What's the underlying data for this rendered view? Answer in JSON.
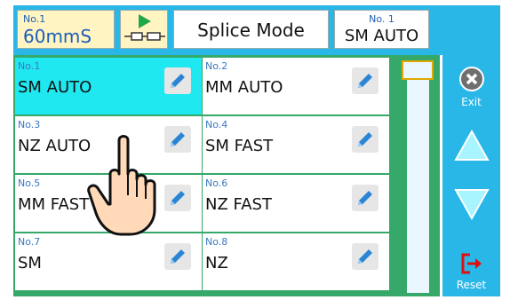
{
  "header": {
    "speed": {
      "small": "No.1",
      "value": "60mmS"
    },
    "mode_title": "Splice Mode",
    "current": {
      "small": "No. 1",
      "value": "SM AUTO"
    }
  },
  "modes": [
    {
      "num": "No.1",
      "name": "SM AUTO",
      "selected": true
    },
    {
      "num": "No.2",
      "name": "MM AUTO",
      "selected": false
    },
    {
      "num": "No.3",
      "name": "NZ AUTO",
      "selected": false
    },
    {
      "num": "No.4",
      "name": "SM FAST",
      "selected": false
    },
    {
      "num": "No.5",
      "name": "MM FAST",
      "selected": false
    },
    {
      "num": "No.6",
      "name": "NZ FAST",
      "selected": false
    },
    {
      "num": "No.7",
      "name": "SM",
      "selected": false
    },
    {
      "num": "No.8",
      "name": "NZ",
      "selected": false
    }
  ],
  "nav": {
    "exit_label": "Exit",
    "reset_label": "Reset"
  },
  "icons": {
    "arc": "arc-play-icon",
    "edit": "pencil-icon",
    "exit": "close-circle-icon",
    "up": "triangle-up-icon",
    "down": "triangle-down-icon",
    "reset": "reset-exit-icon",
    "hand": "hand-pointer-icon"
  },
  "colors": {
    "titlebar": "#29b7e8",
    "grid_bg": "#35a86a",
    "selected": "#20e8f0",
    "accent_blue": "#1b5fb8",
    "scroll_thumb": "#e0a800",
    "reset_red": "#e01010"
  }
}
